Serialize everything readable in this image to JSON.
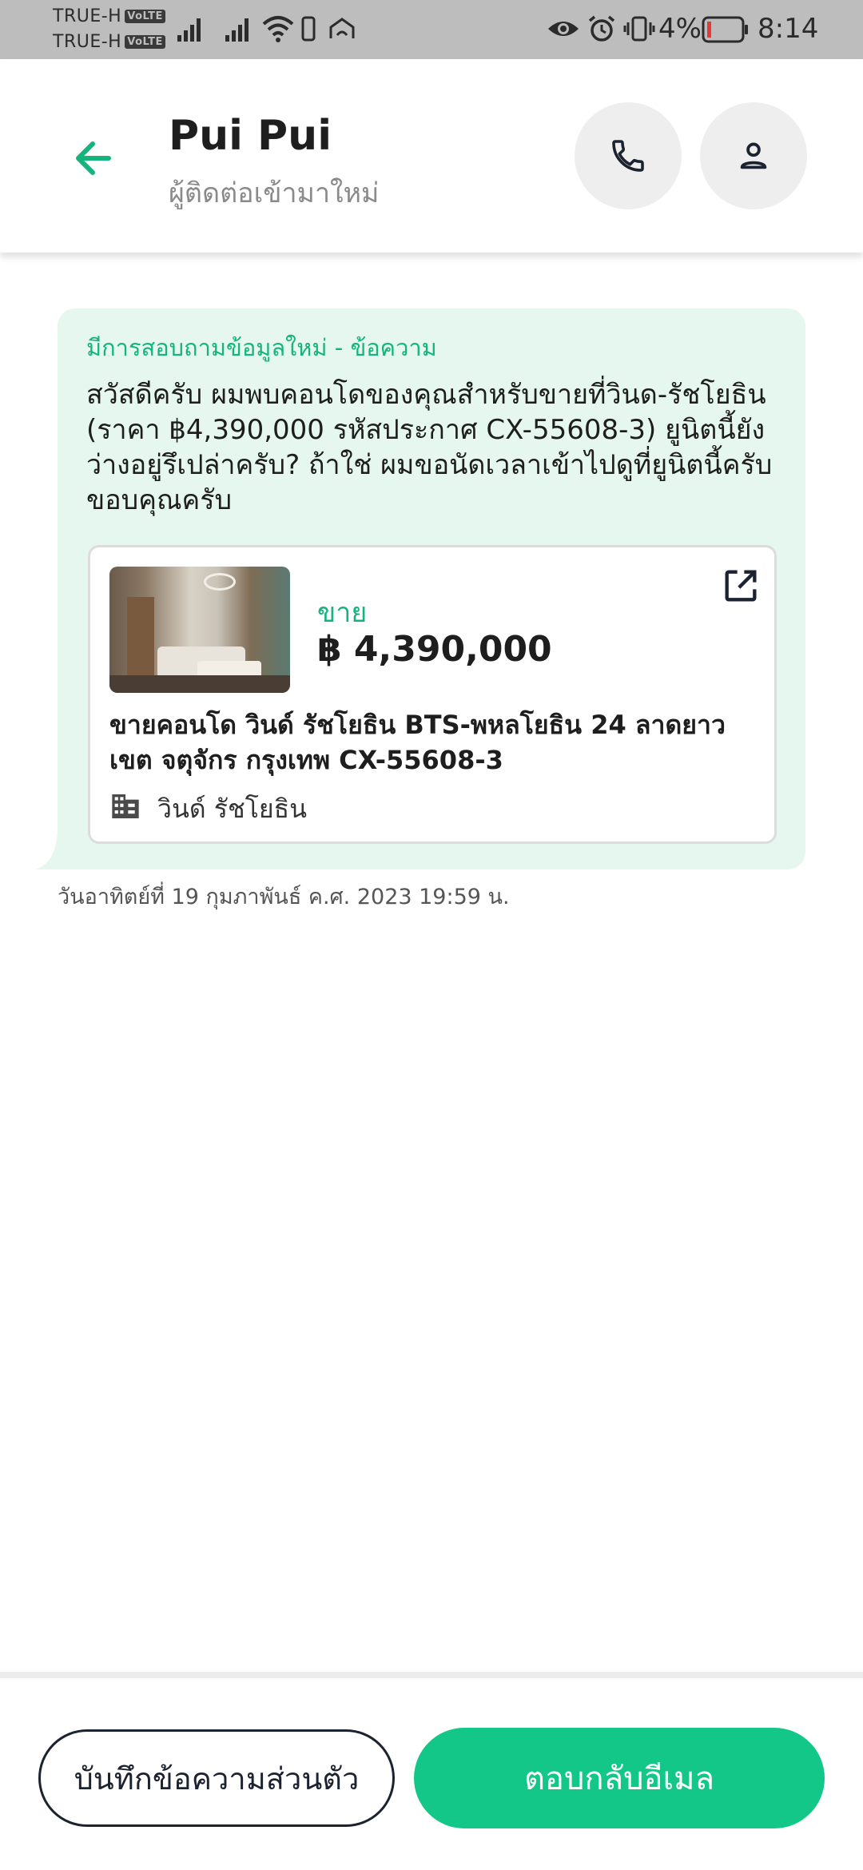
{
  "status_bar": {
    "carrier1": "TRUE-H",
    "carrier2": "TRUE-H",
    "volte": "VoLTE",
    "battery": "4%",
    "time": "8:14"
  },
  "header": {
    "contact_name": "Pui Pui",
    "contact_status": "ผู้ติดต่อเข้ามาใหม่"
  },
  "message": {
    "title": "มีการสอบถามข้อมูลใหม่ - ข้อความ",
    "body": "สวัสดีครับ ผมพบคอนโดของคุณสำหรับขายที่วินด-รัชโยธิน (ราคา ฿4,390,000 รหัสประกาศ CX-55608-3) ยูนิตนี้ยังว่างอยู่รึเปล่าครับ? ถ้าใช่ ผมขอนัดเวลาเข้าไปดูที่ยูนิตนี้ครับ ขอบคุณครับ",
    "timestamp": "วันอาทิตย์ที่ 19 กุมภาพันธ์ ค.ศ. 2023 19:59 น."
  },
  "listing": {
    "type_label": "ขาย",
    "price": "฿ 4,390,000",
    "title": "ขายคอนโด  วินด์ รัชโยธิน BTS-พหลโยธิน 24 ลาดยาว เขต จตุจักร กรุงเทพ CX-55608-3",
    "project": "วินด์ รัชโยธิน"
  },
  "actions": {
    "private_note": "บันทึกข้อความส่วนตัว",
    "reply_email": "ตอบกลับอีเมล"
  },
  "colors": {
    "accent": "#13c788",
    "bubble": "#e5f7ef",
    "status_bar": "#bdbdbd"
  }
}
